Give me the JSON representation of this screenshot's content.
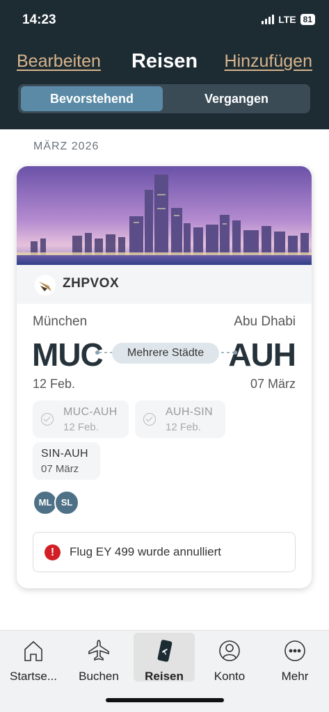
{
  "status_bar": {
    "time": "14:23",
    "network": "LTE",
    "battery": "81"
  },
  "nav": {
    "left": "Bearbeiten",
    "title": "Reisen",
    "right": "Hinzufügen"
  },
  "segment": {
    "active": "Bevorstehend",
    "inactive": "Vergangen"
  },
  "month_header": "MÄRZ 2026",
  "trip": {
    "booking_code": "ZHPVOX",
    "origin_city": "München",
    "origin_code": "MUC",
    "origin_date": "12 Feb.",
    "dest_city": "Abu Dhabi",
    "dest_code": "AUH",
    "dest_date": "07 März",
    "route_label": "Mehrere Städte",
    "segments": [
      {
        "route": "MUC-AUH",
        "date": "12 Feb.",
        "completed": true
      },
      {
        "route": "AUH-SIN",
        "date": "12 Feb.",
        "completed": true
      },
      {
        "route": "SIN-AUH",
        "date": "07 März",
        "completed": false
      }
    ],
    "travelers": [
      "ML",
      "SL"
    ],
    "alert": "Flug EY 499 wurde annulliert"
  },
  "tabs": [
    {
      "label": "Startse...",
      "icon": "home-icon"
    },
    {
      "label": "Buchen",
      "icon": "airplane-icon"
    },
    {
      "label": "Reisen",
      "icon": "boarding-pass-icon",
      "active": true
    },
    {
      "label": "Konto",
      "icon": "user-icon"
    },
    {
      "label": "Mehr",
      "icon": "more-icon"
    }
  ],
  "colors": {
    "header_bg": "#1d2b33",
    "accent_link": "#d8b58c",
    "segment_active": "#5a8aa6",
    "alert_red": "#d21f26"
  }
}
